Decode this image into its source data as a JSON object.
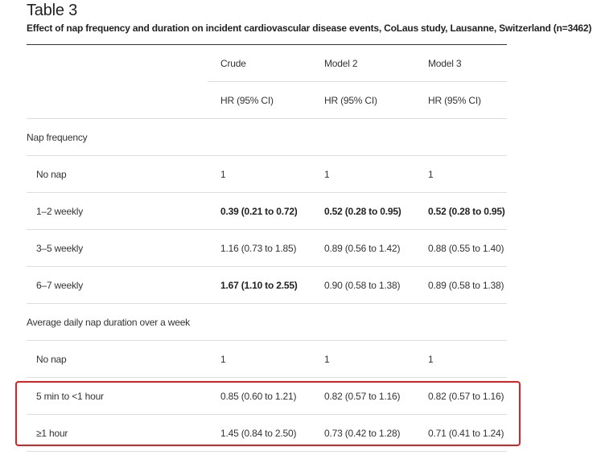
{
  "table": {
    "title": "Table 3",
    "caption": "Effect of nap frequency and duration on incident cardiovascular disease events, CoLaus study, Lausanne, Switzerland (n=3462)",
    "header_models": [
      "Crude",
      "Model 2",
      "Model 3"
    ],
    "header_metric": [
      "HR (95% CI)",
      "HR (95% CI)",
      "HR (95% CI)"
    ],
    "rows": [
      {
        "label": "Nap frequency",
        "kind": "section",
        "values": [
          "",
          "",
          ""
        ],
        "bold": [
          false,
          false,
          false
        ]
      },
      {
        "label": "No nap",
        "kind": "item",
        "values": [
          "1",
          "1",
          "1"
        ],
        "bold": [
          false,
          false,
          false
        ]
      },
      {
        "label": "1–2 weekly",
        "kind": "item",
        "values": [
          "0.39 (0.21 to 0.72)",
          "0.52 (0.28 to 0.95)",
          "0.52 (0.28 to 0.95)"
        ],
        "bold": [
          true,
          true,
          true
        ]
      },
      {
        "label": "3–5 weekly",
        "kind": "item",
        "values": [
          "1.16 (0.73 to 1.85)",
          "0.89 (0.56 to 1.42)",
          "0.88 (0.55 to 1.40)"
        ],
        "bold": [
          false,
          false,
          false
        ]
      },
      {
        "label": "6–7 weekly",
        "kind": "item",
        "values": [
          "1.67 (1.10 to 2.55)",
          "0.90 (0.58 to 1.38)",
          "0.89 (0.58 to 1.38)"
        ],
        "bold": [
          true,
          false,
          false
        ]
      },
      {
        "label": "Average daily nap duration over a week",
        "kind": "section",
        "values": [
          "",
          "",
          ""
        ],
        "bold": [
          false,
          false,
          false
        ]
      },
      {
        "label": "No nap",
        "kind": "item",
        "values": [
          "1",
          "1",
          "1"
        ],
        "bold": [
          false,
          false,
          false
        ]
      },
      {
        "label": "5 min to <1 hour",
        "kind": "item",
        "values": [
          "0.85 (0.60 to 1.21)",
          "0.82 (0.57 to 1.16)",
          "0.82 (0.57 to 1.16)"
        ],
        "bold": [
          false,
          false,
          false
        ]
      },
      {
        "label": "≥1 hour",
        "kind": "item",
        "values": [
          "1.45 (0.84 to 2.50)",
          "0.73 (0.42 to 1.28)",
          "0.71 (0.41 to 1.24)"
        ],
        "bold": [
          false,
          false,
          false
        ]
      }
    ]
  },
  "annotation": {
    "highlight_color": "#e02020"
  }
}
